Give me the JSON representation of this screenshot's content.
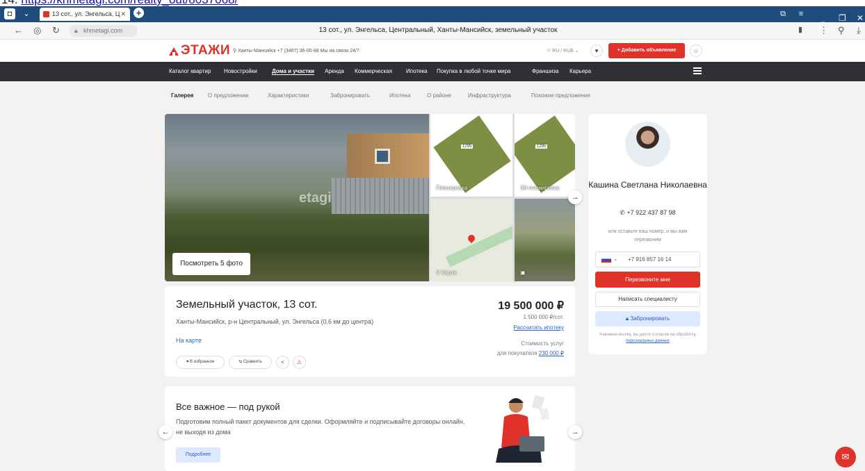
{
  "caption": {
    "prefix": "14. ",
    "link": "https://khmetagi.com/realty_out/8037068/"
  },
  "browser": {
    "tab_title": "13 сот., ул. Энгельса, Ц",
    "url": "khmetagi.com",
    "page_title": "13 сот., ул. Энгельса, Центральный, Ханты-Мансийск, земельный участок"
  },
  "header": {
    "logo": "ЭТАЖИ",
    "info": "⚲ Ханты-Мансийск  +7 (3467) 36-00-88  Мы на связи 24/7",
    "lang": "☉ RU / RUB ⌄",
    "add_label": "+ Добавить объявление"
  },
  "mainnav": [
    "Каталог квартир",
    "Новостройки",
    "Дома и участки",
    "Аренда",
    "Коммерческая",
    "Ипотека",
    "Покупка в любой точке мира",
    "Франшиза",
    "Карьера"
  ],
  "subnav": [
    "Галерея",
    "О предложении",
    "Характеристики",
    "Забронировать",
    "Ипотека",
    "О районе",
    "Инфраструктура",
    "Похожие предложения"
  ],
  "gallery": {
    "watermark": "etagi",
    "view_photos": "Посмотреть 5 фото",
    "thumbs": [
      "Планировка",
      "3D-планировка",
      "Карта",
      ""
    ]
  },
  "listing": {
    "title": "Земельный участок, 13 сот.",
    "address": "Ханты-Мансийск, р-н Центральный, ул. Энгельса (0.6 км до центра)",
    "map_link": "На карте",
    "price": "19 500 000 ₽",
    "price_per": "1 500 000 ₽/сот.",
    "mortgage": "Рассчитать ипотеку",
    "service_cost_label": "Стоимость услуг",
    "service_cost_for": "для покупателя",
    "service_cost_value": "230 000 ₽",
    "fav_label": "♥ В избранное",
    "compare_label": "⇆ Сравнить"
  },
  "promo": {
    "title": "Все важное — под рукой",
    "text": "Подготовим полный пакет документов для сделки. Оформляйте и подписывайте договоры онлайн, не выходя из дома",
    "button": "Подробнее"
  },
  "agent": {
    "name": "Кашина Светлана Николаевна",
    "phone": "+7 922 437 87 98",
    "hint": "или оставьте ваш номер, и мы вам перезвоним",
    "phone_input": "+7 916 857 16 14",
    "call_me": "Перезвоните мне",
    "write": "Написать специалисту",
    "book": "Забронировать",
    "legal_prefix": "Нажимая кнопку, вы даете согласие на обработку",
    "legal_link": "персональных данных"
  },
  "colors": {
    "brand": "#e1322a",
    "nav_bg": "#2f3035",
    "link": "#2a64c9",
    "tabstrip": "#1f4c7a"
  }
}
